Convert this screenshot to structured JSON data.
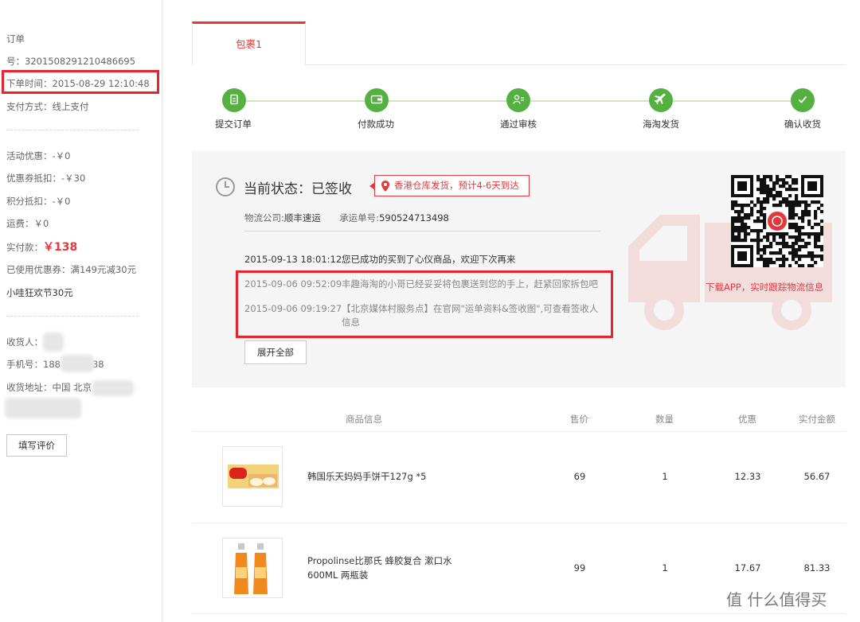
{
  "order": {
    "heading": "订单",
    "number_line": "号：3201508291210486695",
    "order_time": "下单时间：2015-08-29 12:10:48",
    "pay_method": "支付方式：线上支付"
  },
  "costs": {
    "activity": "活动优惠：-￥0",
    "coupon": "优惠券抵扣：-￥30",
    "points": "积分抵扣：-￥0",
    "shipping": "运费：￥0",
    "paid_label": "实付款：",
    "paid_value": "￥138",
    "used_coupon": "已使用优惠券：满149元减30元",
    "promo": "小哇狂欢节30元"
  },
  "receiver": {
    "name_label": "收货人：",
    "phone_label": "手机号：",
    "phone_start": "188",
    "phone_end": "38",
    "address_label": "收货地址：中国 北京"
  },
  "review_button": "填写评价",
  "tab": "包裹1",
  "steps": [
    {
      "label": "提交订单",
      "icon": "document-icon"
    },
    {
      "label": "付款成功",
      "icon": "wallet-icon"
    },
    {
      "label": "通过审核",
      "icon": "review-icon"
    },
    {
      "label": "海淘发货",
      "icon": "plane-icon"
    },
    {
      "label": "确认收货",
      "icon": "check-icon"
    }
  ],
  "status": {
    "title": "当前状态：已签收",
    "warehouse": "香港仓库发货，预计4-6天到达",
    "carrier_label": "物流公司:",
    "carrier": "顺丰速运",
    "tracking_label": "承运单号:",
    "tracking": "590524713498",
    "logs": [
      {
        "time": "2015-09-13 18:01:12",
        "text": "您已成功的买到了心仪商品，欢迎下次再来"
      },
      {
        "time": "2015-09-06 09:52:09",
        "text": "丰趣海淘的小哥已经妥妥将包裹送到您的手上，赶紧回家拆包吧"
      },
      {
        "time": "2015-09-06 09:19:27",
        "text": "【北京媒体村服务点】在官网\"运单资料&签收图\",可查看签收人",
        "text2": "信息"
      }
    ],
    "expand_button": "展开全部",
    "qr_caption": "下载APP，实时跟踪物流信息"
  },
  "table": {
    "headers": [
      "商品信息",
      "售价",
      "数量",
      "优惠",
      "实付金额"
    ],
    "rows": [
      {
        "name": "韩国乐天妈妈手饼干127g *5",
        "name2": "",
        "price": "69",
        "qty": "1",
        "discount": "12.33",
        "paid": "56.67"
      },
      {
        "name": "Propolinse比那氏 蜂胶复合 漱口水",
        "name2": "600ML 两瓶装",
        "price": "99",
        "qty": "1",
        "discount": "17.67",
        "paid": "81.33"
      }
    ]
  },
  "watermark": "值 什么值得买",
  "colors": {
    "accent": "#e4393c",
    "step_green": "#54b141",
    "highlight": "#e8232c"
  }
}
